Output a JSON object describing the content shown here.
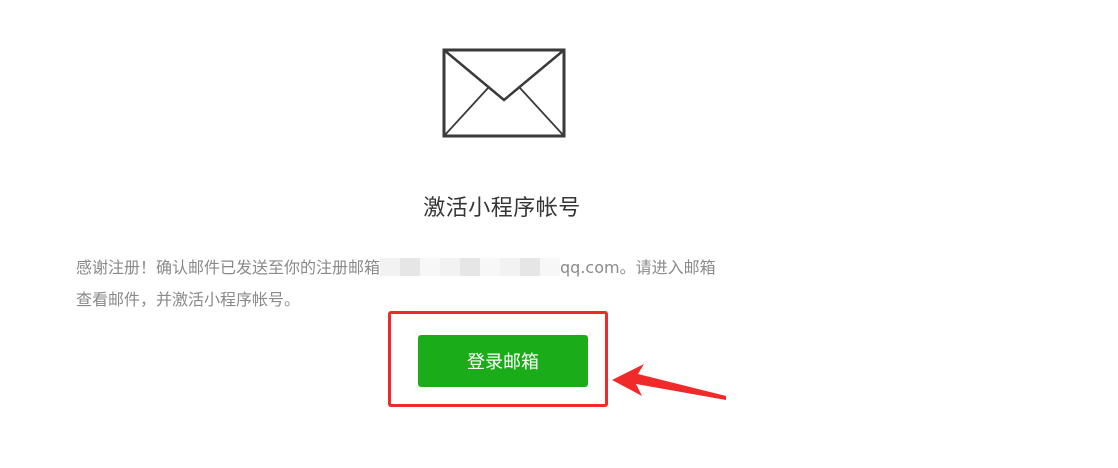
{
  "envelope_icon": "envelope-icon",
  "title": "激活小程序帐号",
  "description": {
    "line1_prefix": "感谢注册！确认邮件已发送至你的注册邮箱",
    "line1_suffix": "qq.com。请进入邮箱",
    "line2": "查看邮件，并激活小程序帐号。"
  },
  "login_button": {
    "label": "登录邮箱"
  },
  "colors": {
    "button_green": "#1aad19",
    "annotation_red": "#f02a2a",
    "description_gray": "#8a8a8a",
    "title_dark": "#353535"
  }
}
